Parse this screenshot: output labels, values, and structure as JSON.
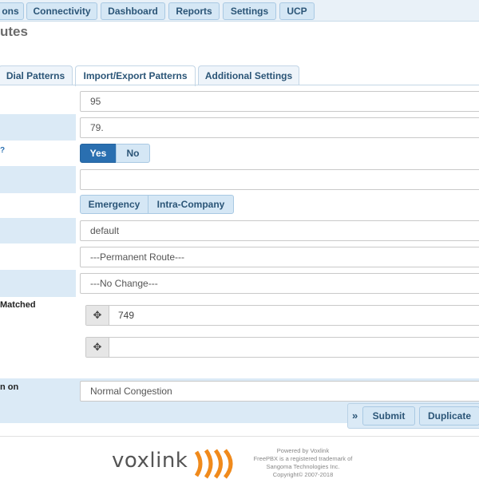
{
  "nav": {
    "items": [
      "ons",
      "Connectivity",
      "Dashboard",
      "Reports",
      "Settings",
      "UCP"
    ]
  },
  "page": {
    "title": "utes"
  },
  "tabs": [
    "Dial Patterns",
    "Import/Export Patterns",
    "Additional Settings"
  ],
  "form": {
    "row1_value": "95",
    "row2_value": "79.",
    "toggle": {
      "yes": "Yes",
      "no": "No",
      "selected": "Yes"
    },
    "row4_value": "",
    "route_type": {
      "emergency": "Emergency",
      "intra_company": "Intra-Company"
    },
    "row6_value": "default",
    "row7_value": "---Permanent Route---",
    "row8_value": "---No Change---",
    "trunk_label": "Matched",
    "trunk1_value": "749",
    "trunk2_value": "",
    "congestion_label": "n on",
    "congestion_value": "Normal Congestion"
  },
  "actions": {
    "chevron": "»",
    "submit": "Submit",
    "duplicate": "Duplicate"
  },
  "footer": {
    "logo": "voxlink",
    "line1": "Powered by Voxlink",
    "line2": "FreePBX is a registered trademark of",
    "line3": "Sangoma Technologies Inc.",
    "line4": "Copyright© 2007-2018"
  },
  "colors": {
    "accent": "#2a6fb0",
    "shade": "#dbeaf6",
    "logo_orange": "#f08a1c"
  }
}
